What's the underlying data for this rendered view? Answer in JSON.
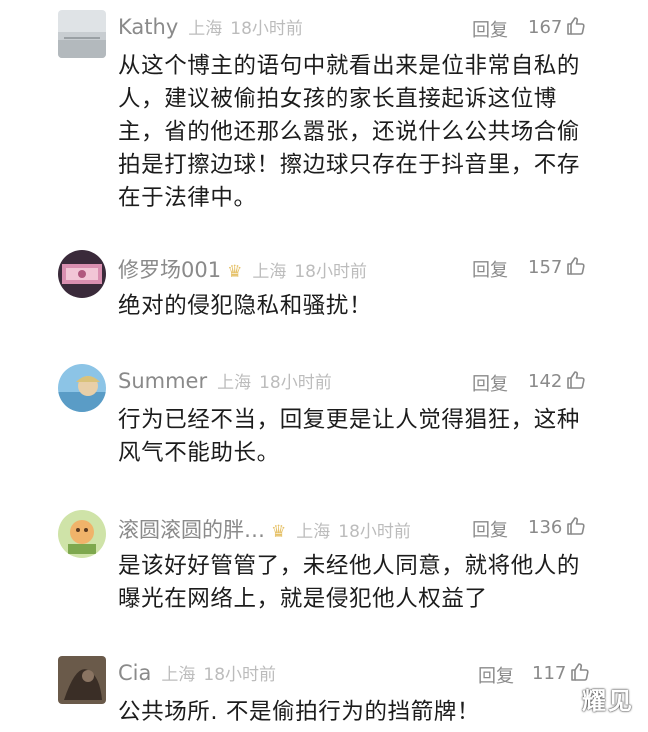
{
  "comments": [
    {
      "username": "Kathy",
      "location": "上海",
      "time": "18小时前",
      "reply_label": "回复",
      "likes": "167",
      "has_badge": false,
      "text_lines": [
        "从这个博主的语句中就看出来是位非常自私的",
        "人，建议被偷拍女孩的家长直接起诉这位博",
        "主，省的他还那么嚣张，还说什么公共场合偷",
        "拍是打擦边球！擦边球只存在于抖音里，不存",
        "在于法律中。"
      ]
    },
    {
      "username": "修罗场001",
      "location": "上海",
      "time": "18小时前",
      "reply_label": "回复",
      "likes": "157",
      "has_badge": true,
      "text_lines": [
        "绝对的侵犯隐私和骚扰！"
      ]
    },
    {
      "username": "Summer",
      "location": "上海",
      "time": "18小时前",
      "reply_label": "回复",
      "likes": "142",
      "has_badge": false,
      "text_lines": [
        "行为已经不当，回复更是让人觉得猖狂，这种",
        "风气不能助长。"
      ]
    },
    {
      "username": "滚圆滚圆的胖…",
      "location": "上海",
      "time": "18小时前",
      "reply_label": "回复",
      "likes": "136",
      "has_badge": true,
      "text_lines": [
        "是该好好管管了，未经他人同意，就将他人的",
        "曝光在网络上，就是侵犯他人权益了"
      ]
    },
    {
      "username": "Cia",
      "location": "上海",
      "time": "18小时前",
      "reply_label": "回复",
      "likes": "117",
      "has_badge": false,
      "text_lines": [
        "公共场所. 不是偷拍行为的挡箭牌！"
      ]
    }
  ],
  "watermark": "耀见",
  "icons": {
    "like": "thumbs-up-icon",
    "badge": "crown-badge-icon"
  },
  "colors": {
    "name": "#8a8a8a",
    "meta": "#bcbcbc",
    "text": "#1c1c1c",
    "badge": "#e6c26a"
  }
}
